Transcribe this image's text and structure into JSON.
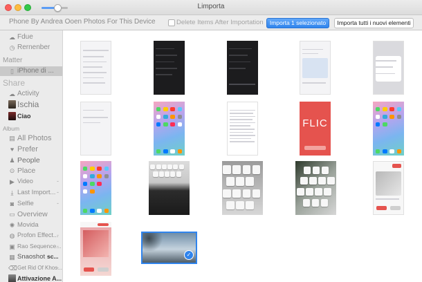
{
  "window": {
    "title": "Limporta"
  },
  "toolbar": {
    "device_name": "Phone By Andrea Ooen Photos For This Device",
    "delete_label": "Delete Items After Importation",
    "import_selected_label": "Importa 1 selezionato",
    "import_all_label": "Importa tutti i nuovi elementi",
    "thumbnail_size": 0.6
  },
  "sidebar": {
    "top_items": [
      {
        "label": "Fdue",
        "icon": "cloud-icon"
      },
      {
        "label": "Rernenber",
        "icon": "clock-icon"
      }
    ],
    "matter_heading": "Matter",
    "device_item": "iPhone di ...",
    "share_heading": "Share",
    "share_items": [
      {
        "label": "Activity",
        "icon": "cloud-icon"
      },
      {
        "label": "Ischia",
        "icon": "album-thumbnail"
      },
      {
        "label": "Ciao",
        "icon": "album-thumbnail"
      }
    ],
    "album_heading": "Album",
    "album_items": [
      {
        "label": "All Photos",
        "icon": "photos-icon"
      },
      {
        "label": "Prefer",
        "icon": "heart-icon"
      },
      {
        "label": "People",
        "icon": "person-icon"
      },
      {
        "label": "Place",
        "icon": "pin-icon"
      },
      {
        "label": "Video",
        "icon": "video-icon"
      },
      {
        "label": "Last Import...",
        "icon": "import-icon"
      },
      {
        "label": "Selfie",
        "icon": "camera-icon"
      },
      {
        "label": "Overview",
        "icon": "panorama-icon"
      },
      {
        "label": "Movida",
        "icon": "timelapse-icon"
      },
      {
        "label": "Profon Effect...",
        "icon": "depth-icon"
      },
      {
        "label": "Rao Sequence...",
        "icon": "burst-icon"
      },
      {
        "label": "Snaoshot",
        "icon": "screenshot-icon",
        "suffix": "sc..."
      },
      {
        "label": "Get Rid Of Khos...",
        "icon": "trash-icon"
      },
      {
        "label": "Attivazione A...",
        "icon": "album-thumbnail"
      }
    ]
  },
  "grid": {
    "flic_text": "FLIC",
    "selected_check": "✓"
  },
  "colors": {
    "accent": "#2f84ed",
    "sidebar_bg": "#ebebeb",
    "selected_row": "#c9c9c9"
  }
}
